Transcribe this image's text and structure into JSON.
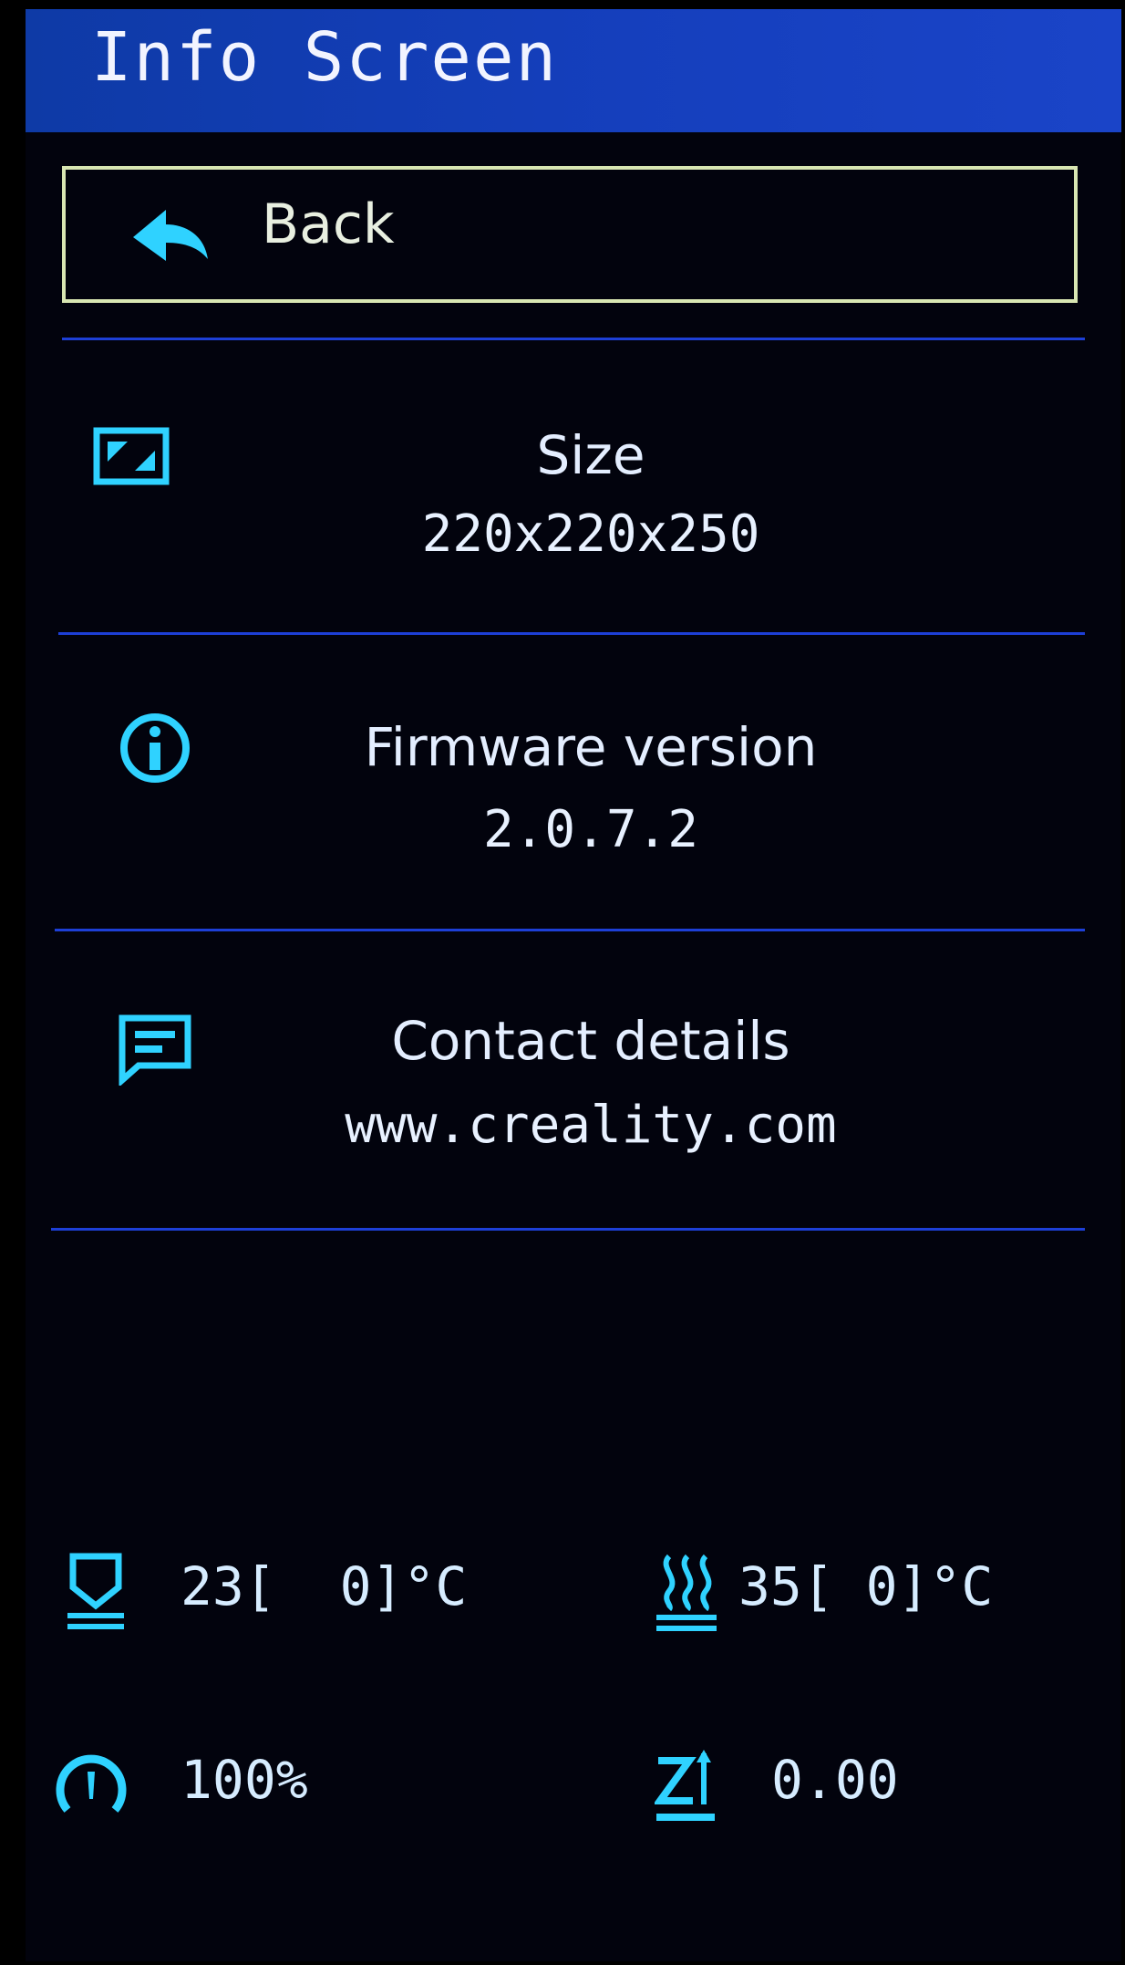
{
  "header": {
    "title": "Info Screen"
  },
  "back_button": {
    "label": "Back",
    "icon": "back-arrow-icon"
  },
  "info_rows": [
    {
      "icon": "size-icon",
      "label": "Size",
      "value": "220x220x250"
    },
    {
      "icon": "info-icon",
      "label": "Firmware version",
      "value": "2.0.7.2"
    },
    {
      "icon": "message-icon",
      "label": "Contact details",
      "value": "www.creality.com"
    }
  ],
  "status": {
    "hotend": {
      "icon": "hotend-icon",
      "text": "23[  0]°C"
    },
    "bed": {
      "icon": "bed-heat-icon",
      "text": "35[ 0]°C"
    },
    "speed": {
      "icon": "speed-gauge-icon",
      "text": "100%"
    },
    "z_offset": {
      "icon": "z-offset-icon",
      "text": "0.00"
    }
  },
  "colors": {
    "title_bar": "#153fbd",
    "background": "#02030d",
    "accent": "#1d3fd6",
    "icon": "#2fd2ff",
    "button_border": "#d8e6b2"
  }
}
